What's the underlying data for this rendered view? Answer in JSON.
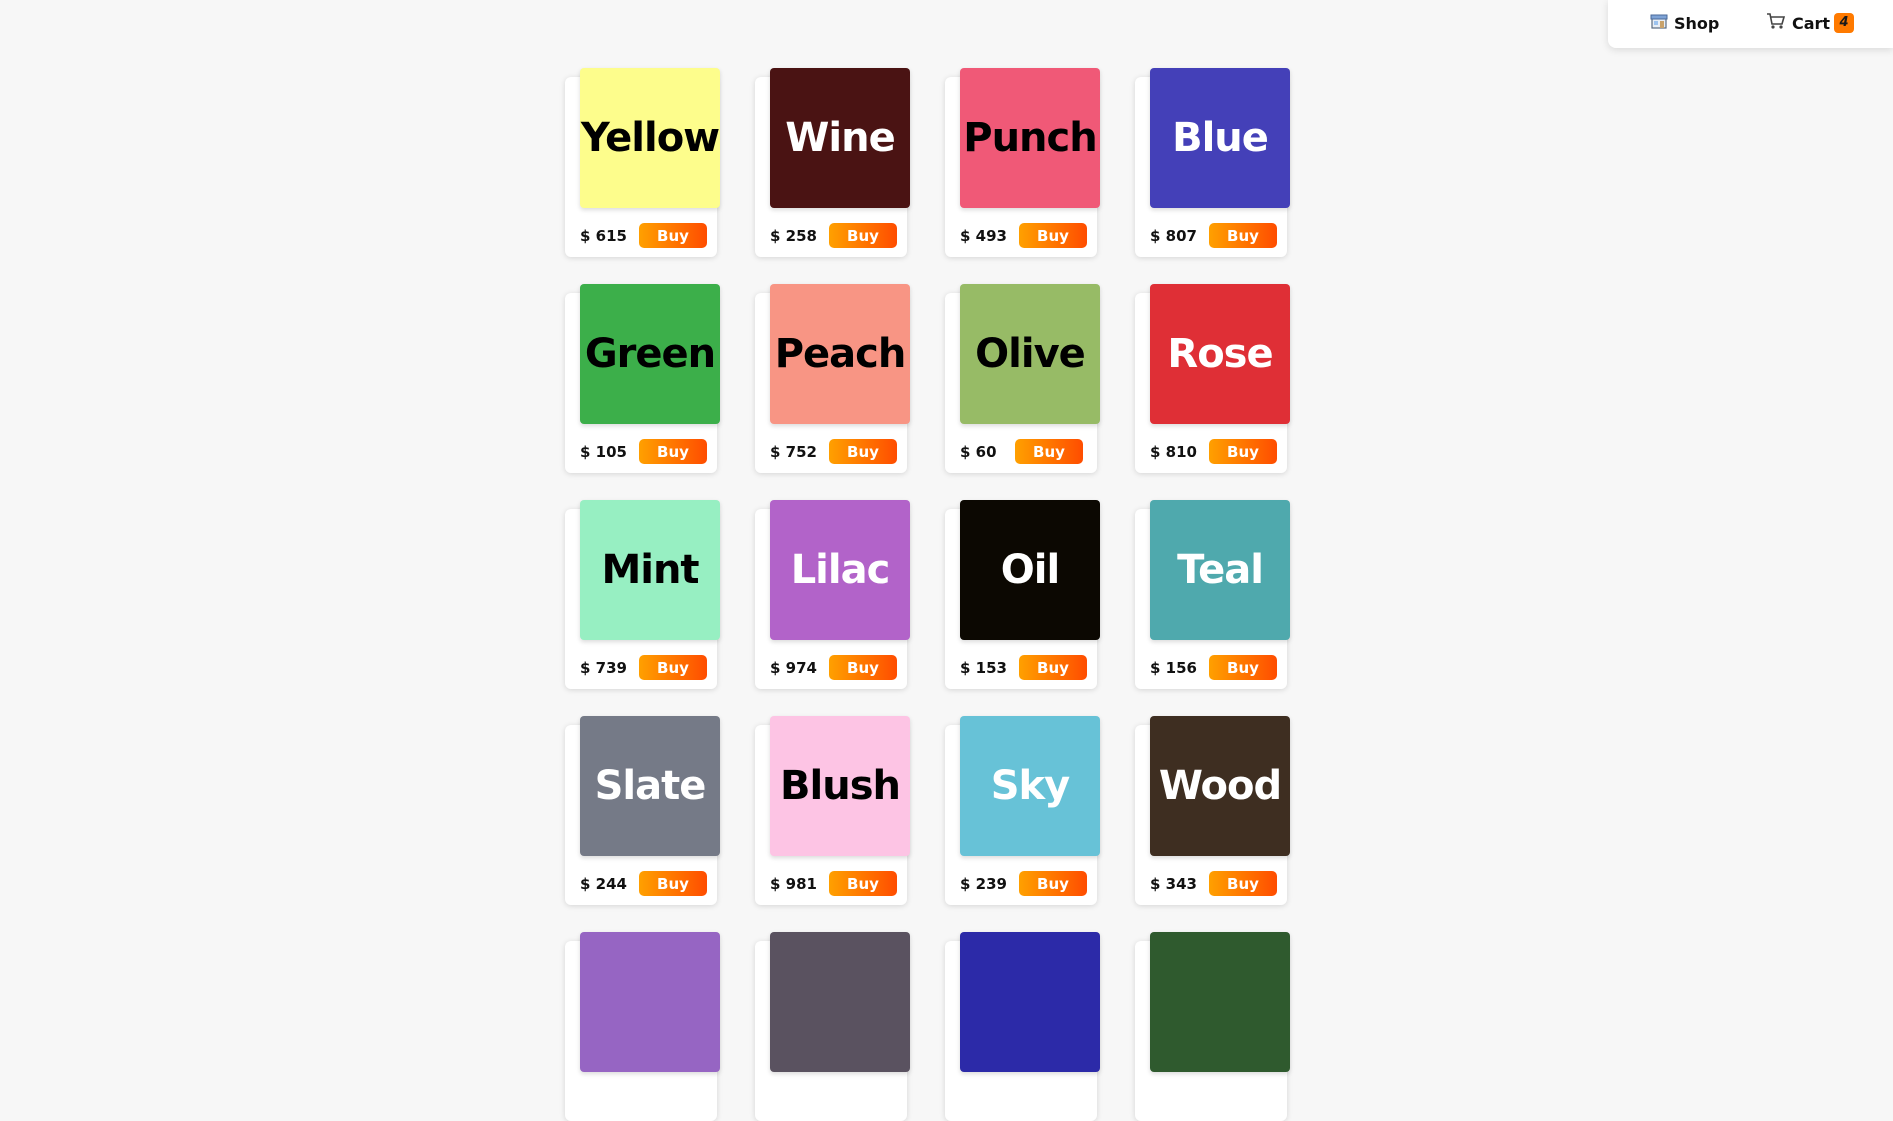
{
  "nav": {
    "shop_label": "Shop",
    "shop_icon": "shop-icon",
    "cart_label": "Cart",
    "cart_icon": "cart-icon",
    "cart_count": "4"
  },
  "buy_label": "Buy",
  "currency": "$",
  "products": [
    {
      "name": "Yellow",
      "price": "615",
      "color": "#fdfd8c",
      "text_color": "#000000"
    },
    {
      "name": "Wine",
      "price": "258",
      "color": "#4a1313",
      "text_color": "#ffffff"
    },
    {
      "name": "Punch",
      "price": "493",
      "color": "#f05977",
      "text_color": "#000000"
    },
    {
      "name": "Blue",
      "price": "807",
      "color": "#4440b8",
      "text_color": "#ffffff"
    },
    {
      "name": "Green",
      "price": "105",
      "color": "#3caf4a",
      "text_color": "#000000"
    },
    {
      "name": "Peach",
      "price": "752",
      "color": "#f89584",
      "text_color": "#000000"
    },
    {
      "name": "Olive",
      "price": "60",
      "color": "#97bb66",
      "text_color": "#000000"
    },
    {
      "name": "Rose",
      "price": "810",
      "color": "#df2f36",
      "text_color": "#ffffff"
    },
    {
      "name": "Mint",
      "price": "739",
      "color": "#97efc2",
      "text_color": "#000000"
    },
    {
      "name": "Lilac",
      "price": "974",
      "color": "#b263c9",
      "text_color": "#ffffff"
    },
    {
      "name": "Oil",
      "price": "153",
      "color": "#0c0802",
      "text_color": "#ffffff"
    },
    {
      "name": "Teal",
      "price": "156",
      "color": "#4fa9ad",
      "text_color": "#ffffff"
    },
    {
      "name": "Slate",
      "price": "244",
      "color": "#757a87",
      "text_color": "#ffffff"
    },
    {
      "name": "Blush",
      "price": "981",
      "color": "#fdc4e4",
      "text_color": "#000000"
    },
    {
      "name": "Sky",
      "price": "239",
      "color": "#67c2d7",
      "text_color": "#ffffff"
    },
    {
      "name": "Wood",
      "price": "343",
      "color": "#3e2e21",
      "text_color": "#ffffff"
    },
    {
      "name": "",
      "price": "",
      "color": "#9665c3",
      "text_color": "#ffffff"
    },
    {
      "name": "",
      "price": "",
      "color": "#5a5260",
      "text_color": "#ffffff"
    },
    {
      "name": "",
      "price": "",
      "color": "#2c2aa8",
      "text_color": "#ffffff"
    },
    {
      "name": "",
      "price": "",
      "color": "#2f5a2e",
      "text_color": "#ffffff"
    }
  ]
}
